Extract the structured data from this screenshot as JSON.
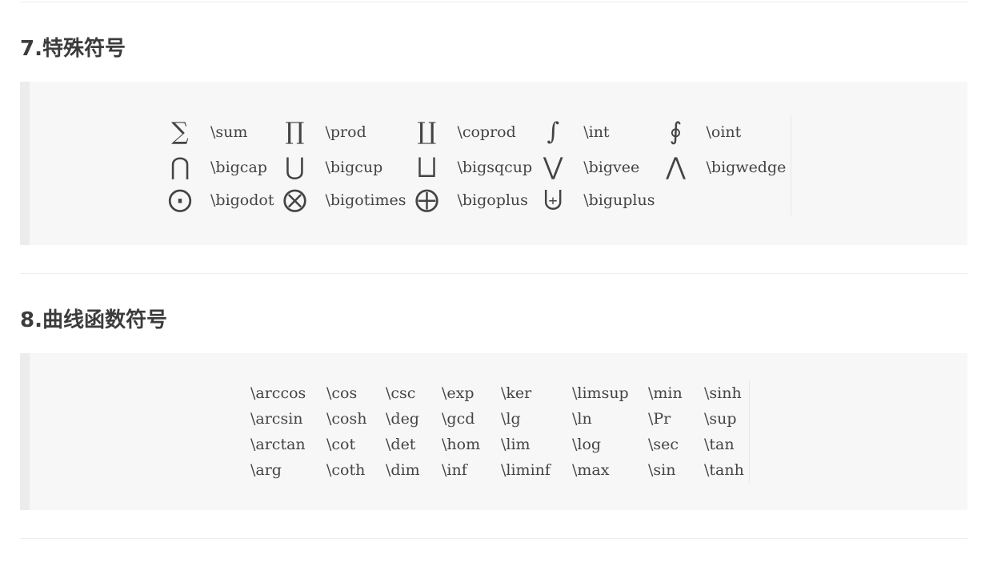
{
  "section7": {
    "heading": "7.特殊符号",
    "rows": [
      [
        {
          "symbol": "∑",
          "command": "\\sum"
        },
        {
          "symbol": "∏",
          "command": "\\prod"
        },
        {
          "symbol": "∐",
          "command": "\\coprod"
        },
        {
          "symbol": "∫",
          "command": "\\int"
        },
        {
          "symbol": "∮",
          "command": "\\oint"
        }
      ],
      [
        {
          "symbol": "⋂",
          "command": "\\bigcap"
        },
        {
          "symbol": "⋃",
          "command": "\\bigcup"
        },
        {
          "symbol": "⨆",
          "command": "\\bigsqcup"
        },
        {
          "symbol": "⋁",
          "command": "\\bigvee"
        },
        {
          "symbol": "⋀",
          "command": "\\bigwedge"
        }
      ],
      [
        {
          "symbol": "⨀",
          "command": "\\bigodot"
        },
        {
          "symbol": "⨂",
          "command": "\\bigotimes"
        },
        {
          "symbol": "⨁",
          "command": "\\bigoplus"
        },
        {
          "symbol": "⨄",
          "command": "\\biguplus"
        },
        {
          "symbol": "",
          "command": ""
        }
      ]
    ]
  },
  "section8": {
    "heading": "8.曲线函数符号",
    "rows": [
      [
        "\\arccos",
        "\\cos",
        "\\csc",
        "\\exp",
        "\\ker",
        "\\limsup",
        "\\min",
        "\\sinh"
      ],
      [
        "\\arcsin",
        "\\cosh",
        "\\deg",
        "\\gcd",
        "\\lg",
        "\\ln",
        "\\Pr",
        "\\sup"
      ],
      [
        "\\arctan",
        "\\cot",
        "\\det",
        "\\hom",
        "\\lim",
        "\\log",
        "\\sec",
        "\\tan"
      ],
      [
        "\\arg",
        "\\coth",
        "\\dim",
        "\\inf",
        "\\liminf",
        "\\max",
        "\\sin",
        "\\tanh"
      ]
    ]
  }
}
